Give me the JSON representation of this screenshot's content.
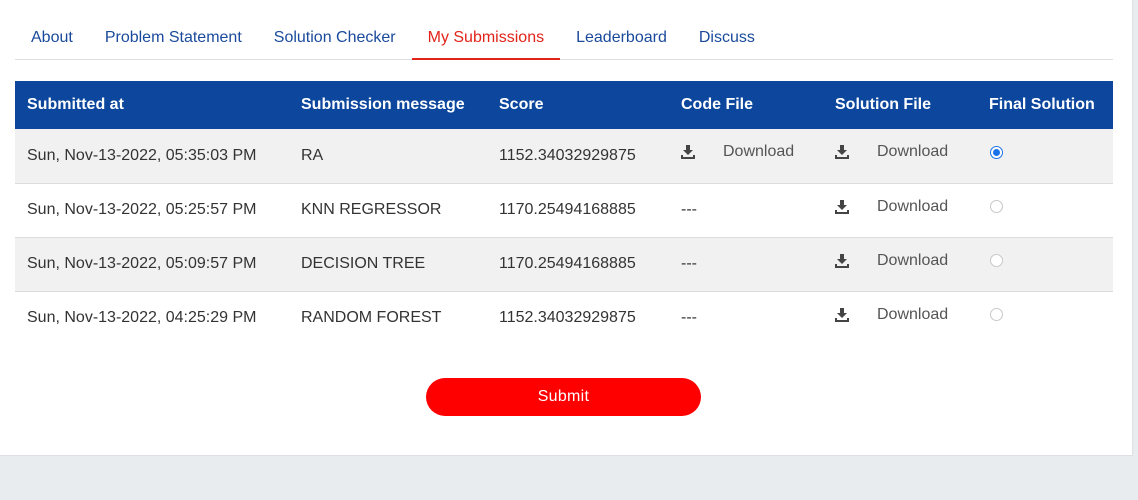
{
  "tabs": [
    {
      "label": "About"
    },
    {
      "label": "Problem Statement"
    },
    {
      "label": "Solution Checker"
    },
    {
      "label": "My Submissions",
      "active": true
    },
    {
      "label": "Leaderboard"
    },
    {
      "label": "Discuss"
    }
  ],
  "table": {
    "headers": [
      "Submitted at",
      "Submission message",
      "Score",
      "Code File",
      "Solution File",
      "Final Solution"
    ],
    "rows": [
      {
        "submitted_at": "Sun, Nov-13-2022, 05:35:03 PM",
        "message": "RA",
        "score": "1152.34032929875",
        "code_file": "Download",
        "solution_file": "Download",
        "final": true
      },
      {
        "submitted_at": "Sun, Nov-13-2022, 05:25:57 PM",
        "message": "KNN REGRESSOR",
        "score": "1170.25494168885",
        "code_file": "---",
        "solution_file": "Download",
        "final": false
      },
      {
        "submitted_at": "Sun, Nov-13-2022, 05:09:57 PM",
        "message": "DECISION TREE",
        "score": "1170.25494168885",
        "code_file": "---",
        "solution_file": "Download",
        "final": false
      },
      {
        "submitted_at": "Sun, Nov-13-2022, 04:25:29 PM",
        "message": "RANDOM FOREST",
        "score": "1152.34032929875",
        "code_file": "---",
        "solution_file": "Download",
        "final": false
      }
    ]
  },
  "submit_label": "Submit",
  "colors": {
    "header_bg": "#0c479d",
    "active_tab": "#e2231a",
    "tab_link": "#1a4a9b",
    "submit_bg": "#ff0000",
    "radio_checked": "#1a73e8"
  },
  "icons": {
    "download": "download-icon"
  }
}
